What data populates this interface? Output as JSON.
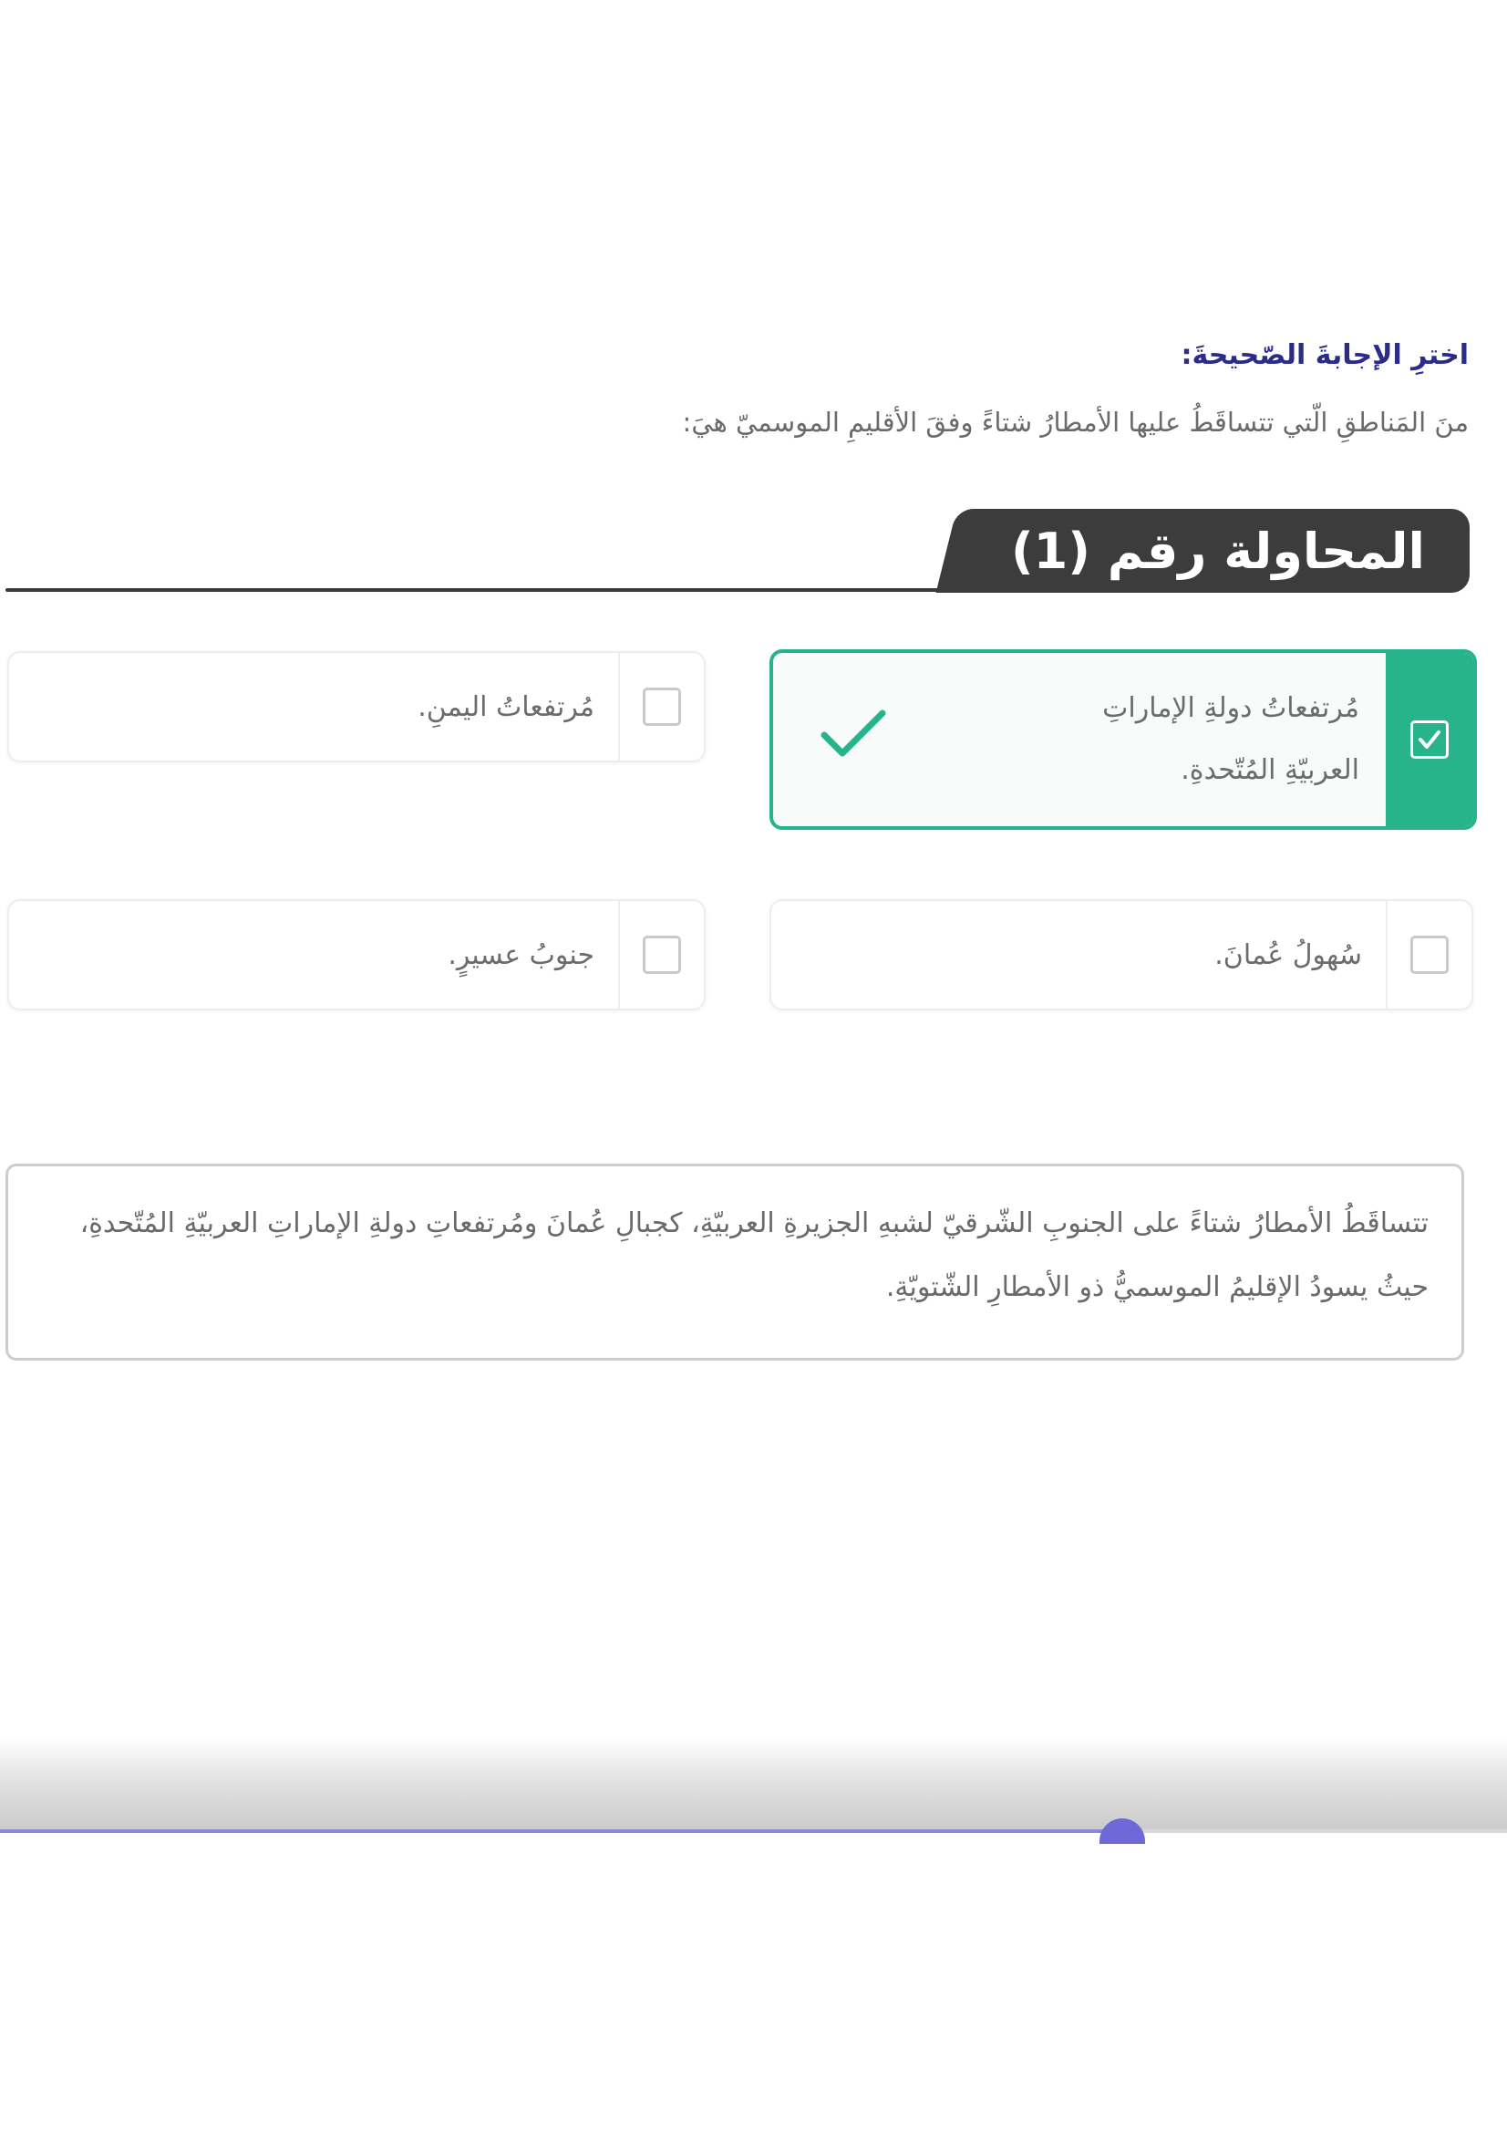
{
  "instruction": "اخترِ الإجابةَ الصّحيحةَ:",
  "question": "منَ المَناطقِ الّتي تتساقَطُ عليها الأمطارُ شتاءً وفقَ الأقليمِ الموسميّ هيَ:",
  "attempt": {
    "title": "المحاولة رقم (1)"
  },
  "options": [
    {
      "label": "مُرتفعاتُ دولةِ الإماراتِ العربيّةِ المُتّحدةِ.",
      "checked": true,
      "correct": true
    },
    {
      "label": "مُرتفعاتُ اليمنِ.",
      "checked": false
    },
    {
      "label": "سُهولُ عُمانَ.",
      "checked": false
    },
    {
      "label": "جنوبُ عسيرٍ.",
      "checked": false
    }
  ],
  "explanation": "تتساقَطُ الأمطارُ شتاءً على الجنوبِ الشّرقيّ لشبهِ الجزيرةِ العربيّةِ، كجبالِ عُمانَ ومُرتفعاتِ دولةِ الإماراتِ العربيّةِ المُتّحدةِ، حيثُ يسودُ الإقليمُ الموسميُّ ذو الأمطارِ الشّتويّةِ.",
  "player": {
    "progress": 0.745
  },
  "colors": {
    "accent": "#27b38b",
    "instruction": "#2b2c8a",
    "tab": "#3c3c3c",
    "progress": "#6f68d8"
  }
}
